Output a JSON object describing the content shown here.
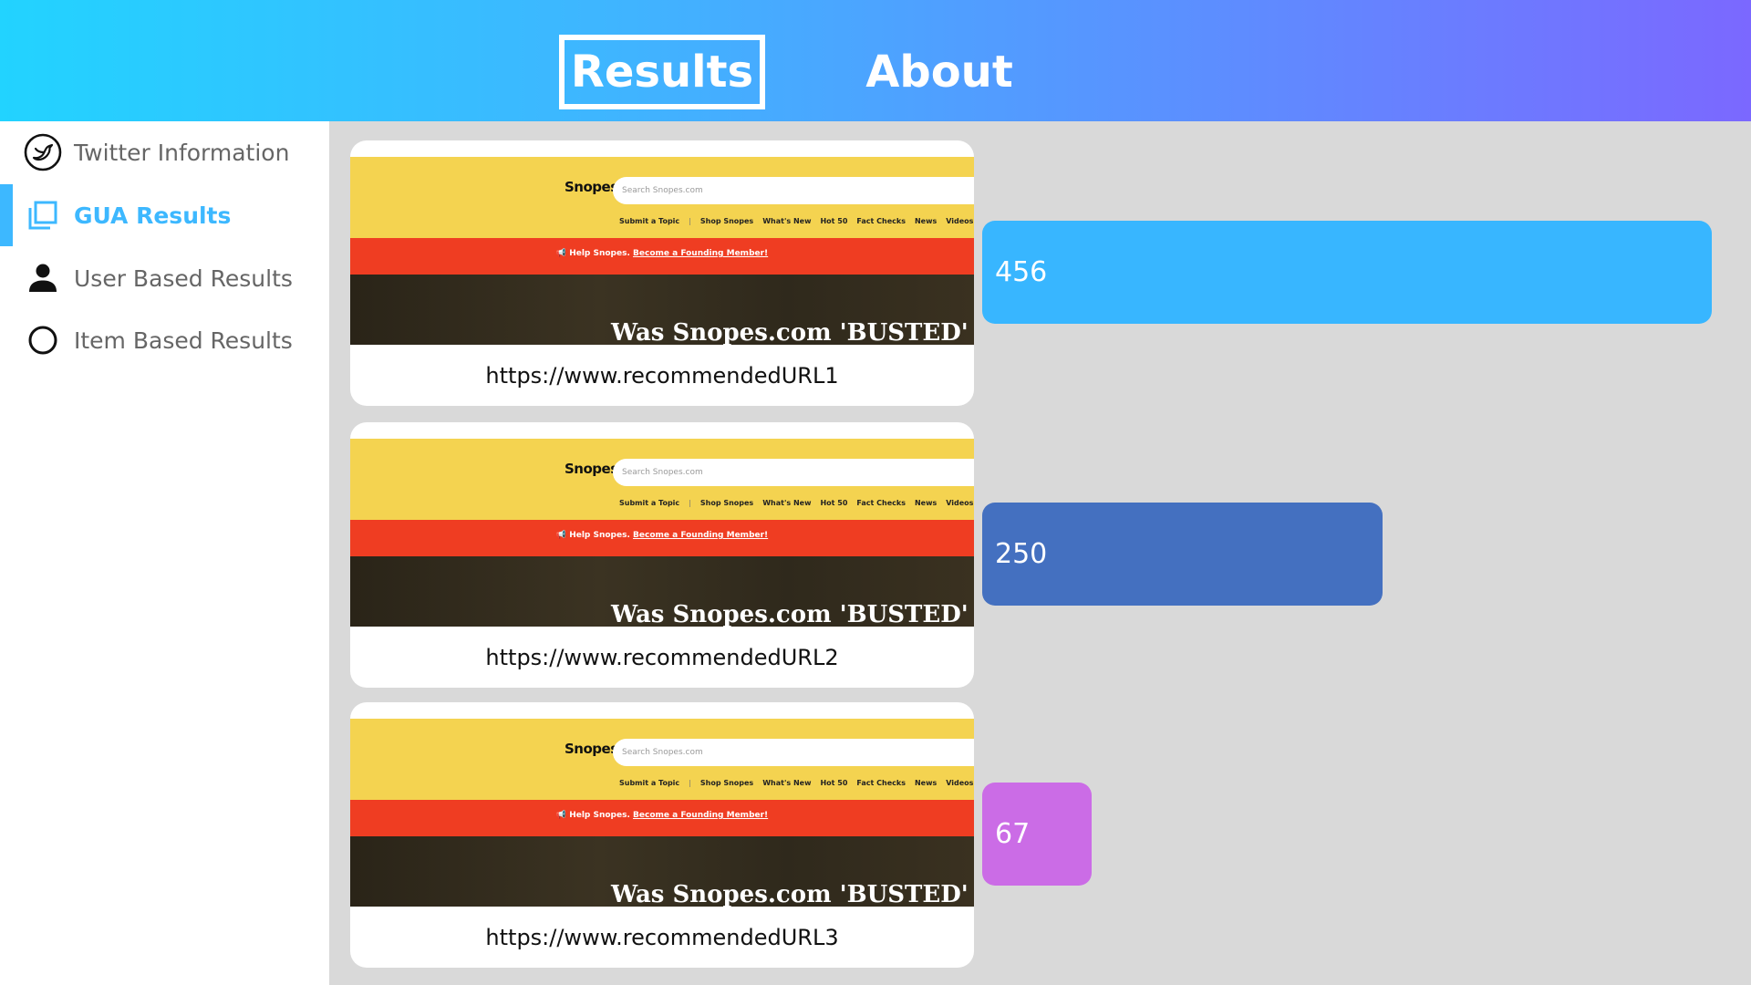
{
  "header": {
    "tabs": [
      {
        "label": "Results",
        "active": true
      },
      {
        "label": "About",
        "active": false
      }
    ]
  },
  "sidebar": {
    "items": [
      {
        "label": "Twitter Information",
        "icon": "twitter-icon",
        "active": false
      },
      {
        "label": "GUA Results",
        "icon": "copy-icon",
        "active": true
      },
      {
        "label": "User Based Results",
        "icon": "person-icon",
        "active": false
      },
      {
        "label": "Item Based Results",
        "icon": "circle-icon",
        "active": false
      }
    ]
  },
  "thumbnail": {
    "logo": "Snopes",
    "search_placeholder": "Search Snopes.com",
    "nav_links": [
      "Submit a Topic",
      "Shop Snopes",
      "What's New",
      "Hot 50",
      "Fact Checks",
      "News",
      "Videos"
    ],
    "help_text": "Help Snopes.",
    "help_link": "Become a Founding Member!",
    "headline": "Was Snopes.com 'BUSTED' f"
  },
  "results": [
    {
      "url": "https://www.recommendedURL1",
      "value": "456",
      "color": "#38b6ff"
    },
    {
      "url": "https://www.recommendedURL2",
      "value": "250",
      "color": "#4470c0"
    },
    {
      "url": "https://www.recommendedURL3",
      "value": "67",
      "color": "#cb6ce6"
    }
  ],
  "colors": {
    "accent": "#3db8ff",
    "main_background": "#d9d9d9",
    "header_gradient_start": "#22d3ff",
    "header_gradient_end": "#7b68ff"
  }
}
